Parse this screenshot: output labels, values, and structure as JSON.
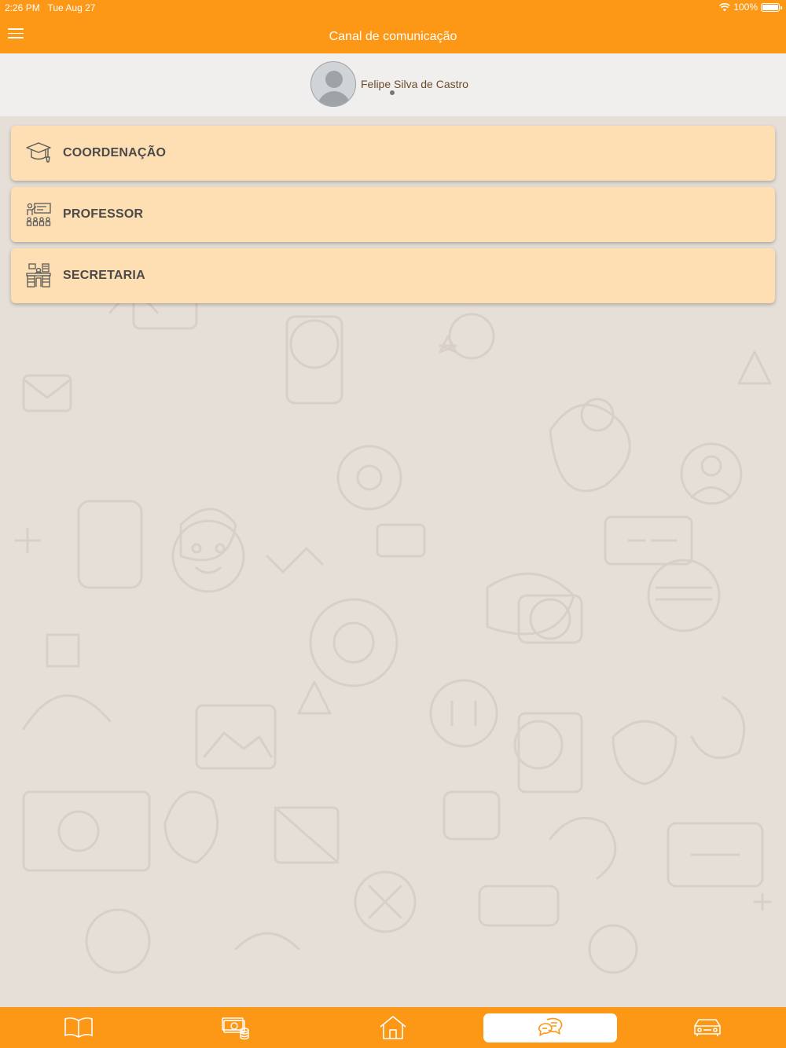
{
  "status_bar": {
    "time": "2:26 PM",
    "date": "Tue Aug 27",
    "battery": "100%"
  },
  "header": {
    "title": "Canal de comunicação"
  },
  "profile": {
    "name": "Felipe Silva de Castro"
  },
  "categories": [
    {
      "label": "COORDENAÇÃO",
      "icon": "graduation-cap-icon"
    },
    {
      "label": "PROFESSOR",
      "icon": "teacher-classroom-icon"
    },
    {
      "label": "SECRETARIA",
      "icon": "office-desk-icon"
    }
  ],
  "tabbar": {
    "tabs": [
      {
        "icon": "book-icon"
      },
      {
        "icon": "money-coins-icon"
      },
      {
        "icon": "home-icon"
      },
      {
        "icon": "chat-icon",
        "active": true
      },
      {
        "icon": "bus-icon"
      }
    ]
  },
  "colors": {
    "accent": "#fd9716",
    "card_background": "#fedfb3",
    "page_background": "#e5dfd8",
    "profile_background": "#f0efee"
  }
}
